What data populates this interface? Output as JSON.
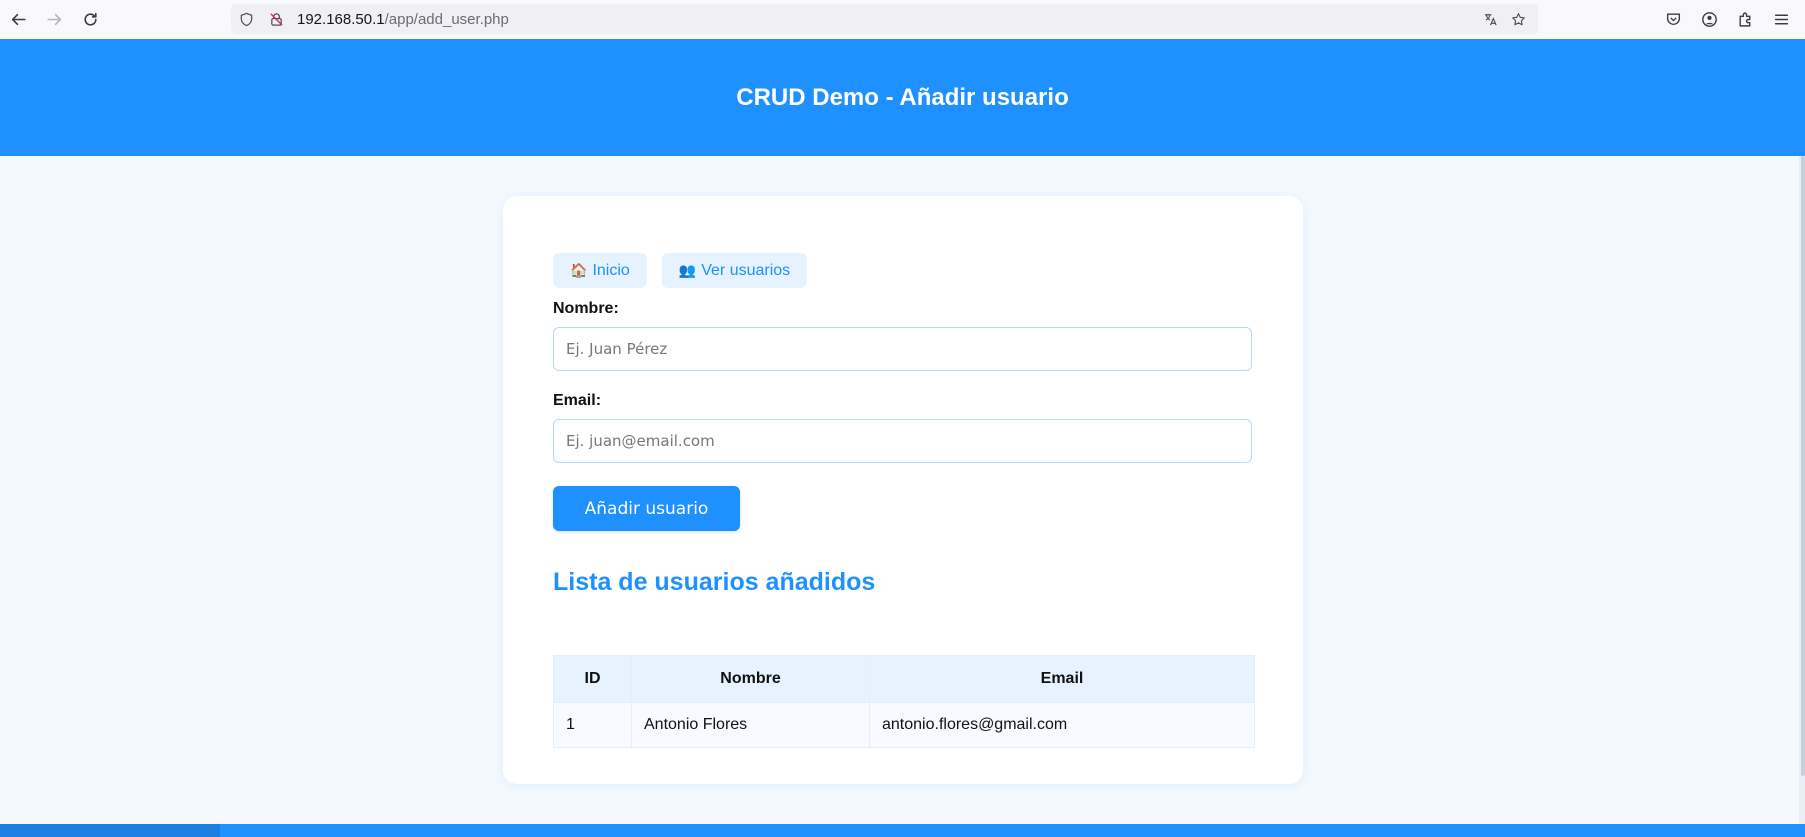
{
  "browser": {
    "url_host": "192.168.50.1",
    "url_path": "/app/add_user.php"
  },
  "header": {
    "title": "CRUD Demo - Añadir usuario"
  },
  "nav": {
    "home_emoji": "🏠",
    "home_label": "Inicio",
    "users_emoji": "👥",
    "users_label": "Ver usuarios"
  },
  "form": {
    "name_label": "Nombre:",
    "name_placeholder": "Ej. Juan Pérez",
    "email_label": "Email:",
    "email_placeholder": "Ej. juan@email.com",
    "submit_label": "Añadir usuario"
  },
  "list": {
    "title": "Lista de usuarios añadidos",
    "columns": [
      "ID",
      "Nombre",
      "Email"
    ],
    "rows": [
      [
        "1",
        "Antonio Flores",
        "antonio.flores@gmail.com"
      ]
    ]
  },
  "colors": {
    "accent": "#1e90ff",
    "background": "#f4f9fe"
  }
}
